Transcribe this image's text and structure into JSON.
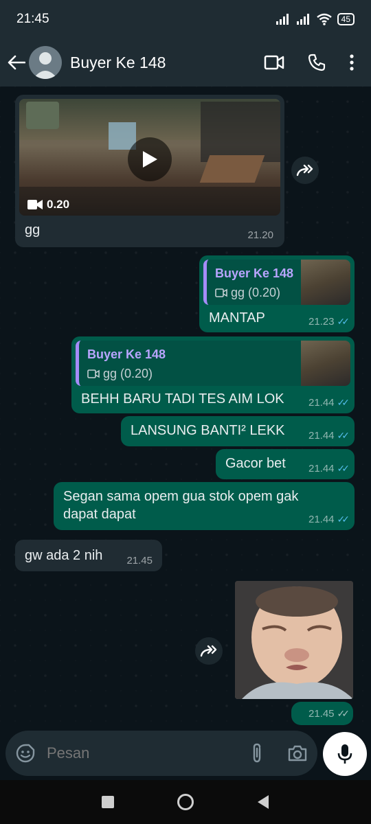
{
  "status_bar": {
    "time": "21:45",
    "battery": "45"
  },
  "header": {
    "contact_name": "Buyer Ke 148"
  },
  "messages": {
    "m1": {
      "video_duration": "0.20",
      "text": "gg",
      "time": "21.20"
    },
    "m2": {
      "quote_name": "Buyer Ke 148",
      "quote_text": "gg (0.20)",
      "text": "MANTAP",
      "time": "21.23"
    },
    "m3": {
      "quote_name": "Buyer Ke 148",
      "quote_text": "gg (0.20)",
      "text": "BEHH BARU TADI TES AIM LOK",
      "time": "21.44"
    },
    "m4": {
      "text": "LANSUNG BANTI² LEKK",
      "time": "21.44"
    },
    "m5": {
      "text": "Gacor bet",
      "time": "21.44"
    },
    "m6": {
      "text_line1": "Segan sama opem gua stok opem gak",
      "text_line2": "dapat dapat",
      "time": "21.44"
    },
    "m7": {
      "text": "gw ada 2 nih",
      "time": "21.45"
    },
    "m8": {
      "time": "21.45"
    }
  },
  "composer": {
    "placeholder": "Pesan"
  },
  "colors": {
    "incoming": "#202c33",
    "outgoing": "#005c4b",
    "read_ticks": "#53bdeb",
    "background": "#0b141a"
  },
  "icons": [
    "back-arrow-icon",
    "video-call-icon",
    "phone-icon",
    "more-icon",
    "forward-icon",
    "video-camera-icon",
    "play-icon",
    "emoji-icon",
    "attach-icon",
    "camera-icon",
    "mic-icon",
    "recents-icon",
    "home-icon",
    "back-icon"
  ]
}
